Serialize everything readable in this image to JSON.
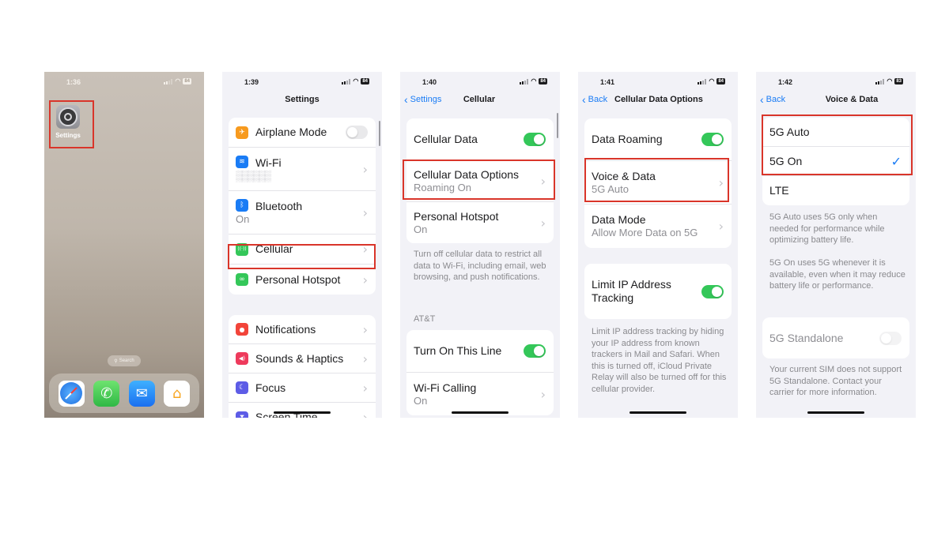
{
  "screens": [
    {
      "id": "home",
      "status": {
        "time": "1:36",
        "battery": "84"
      },
      "app_icon_label": "Settings",
      "search_label": "Search",
      "dock": [
        {
          "name": "safari-icon"
        },
        {
          "name": "phone-icon",
          "glyph": "✆"
        },
        {
          "name": "mail-icon",
          "glyph": "✉"
        },
        {
          "name": "home-app-icon",
          "glyph": "⌂"
        }
      ]
    },
    {
      "id": "settings",
      "status": {
        "time": "1:39",
        "battery": "84"
      },
      "title": "Settings",
      "groups": [
        [
          {
            "label": "Airplane Mode",
            "icon": "airplane-icon",
            "glyph": "✈",
            "color": "#f79a1e",
            "toggle": "off"
          },
          {
            "label": "Wi-Fi",
            "sublabel": "▒▒▒▒▒▒",
            "icon": "wifi-icon",
            "glyph": "≋",
            "color": "#1a7cf5",
            "chevron": true
          },
          {
            "label": "Bluetooth",
            "sublabel": "On",
            "icon": "bluetooth-icon",
            "glyph": "ᛒ",
            "color": "#1a7cf5",
            "chevron": true
          },
          {
            "label": "Cellular",
            "icon": "cellular-icon",
            "glyph": "((·))",
            "color": "#34c759",
            "chevron": true,
            "highlighted": true
          },
          {
            "label": "Personal Hotspot",
            "icon": "hotspot-icon",
            "glyph": "∞",
            "color": "#34c759",
            "chevron": true
          }
        ],
        [
          {
            "label": "Notifications",
            "icon": "notifications-icon",
            "glyph": "🔔",
            "color": "#f2443a",
            "chevron": true
          },
          {
            "label": "Sounds & Haptics",
            "icon": "sounds-icon",
            "glyph": "◀)",
            "color": "#ee3a5c",
            "chevron": true
          },
          {
            "label": "Focus",
            "icon": "focus-icon",
            "glyph": "☾",
            "color": "#5d5ce6",
            "chevron": true
          },
          {
            "label": "Screen Time",
            "icon": "screen-time-icon",
            "glyph": "⧗",
            "color": "#5d5ce6",
            "chevron": true
          }
        ]
      ]
    },
    {
      "id": "cellular",
      "status": {
        "time": "1:40",
        "battery": "84"
      },
      "back": "Settings",
      "title": "Cellular",
      "group1": [
        {
          "label": "Cellular Data",
          "toggle": "on"
        },
        {
          "label": "Cellular Data Options",
          "sublabel": "Roaming On",
          "chevron": true,
          "highlighted": true
        },
        {
          "label": "Personal Hotspot",
          "sublabel": "On",
          "chevron": true
        }
      ],
      "footnote": "Turn off cellular data to restrict all data to Wi-Fi, including email, web browsing, and push notifications.",
      "section_header": "AT&T",
      "group2": [
        {
          "label": "Turn On This Line",
          "toggle": "on"
        },
        {
          "label": "Wi-Fi Calling",
          "sublabel": "On",
          "chevron": true
        }
      ]
    },
    {
      "id": "cellular-data-options",
      "status": {
        "time": "1:41",
        "battery": "84"
      },
      "back": "Back",
      "title": "Cellular Data Options",
      "group1": [
        {
          "label": "Data Roaming",
          "toggle": "on"
        },
        {
          "label": "Voice & Data",
          "sublabel": "5G Auto",
          "chevron": true,
          "highlighted": true
        },
        {
          "label": "Data Mode",
          "sublabel": "Allow More Data on 5G",
          "chevron": true
        }
      ],
      "group2": [
        {
          "label": "Limit IP Address Tracking",
          "toggle": "on"
        }
      ],
      "footnote": "Limit IP address tracking by hiding your IP address from known trackers in Mail and Safari. When this is turned off, iCloud Private Relay will also be turned off for this cellular provider."
    },
    {
      "id": "voice-and-data",
      "status": {
        "time": "1:42",
        "battery": "83"
      },
      "back": "Back",
      "title": "Voice & Data",
      "options": [
        {
          "label": "5G Auto",
          "selected": false
        },
        {
          "label": "5G On",
          "selected": true
        },
        {
          "label": "LTE",
          "selected": false
        }
      ],
      "checkmark": "✓",
      "note1": "5G Auto uses 5G only when needed for performance while optimizing battery life.",
      "note2": "5G On uses 5G whenever it is available, even when it may reduce battery life or performance.",
      "standalone": {
        "label": "5G Standalone",
        "toggle": "off",
        "disabled": true
      },
      "note3": "Your current SIM does not support 5G Standalone. Contact your carrier for more information."
    }
  ],
  "colors": {
    "highlight": "#d9352a",
    "accent": "#1a7cf5",
    "toggle_on": "#34c759"
  }
}
